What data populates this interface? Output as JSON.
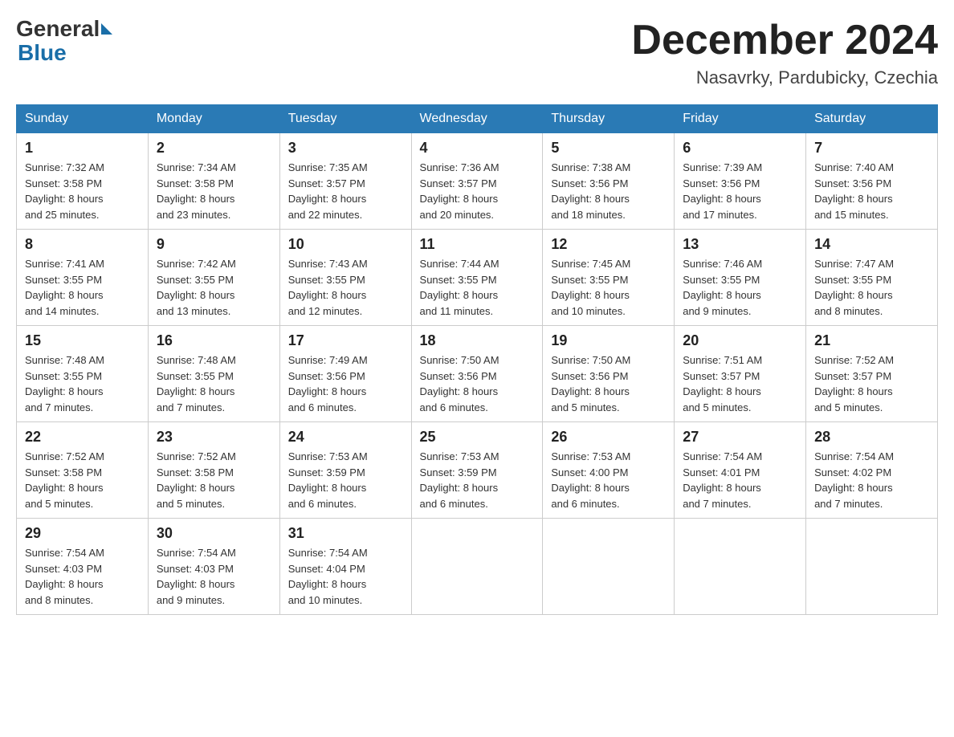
{
  "header": {
    "logo_general": "General",
    "logo_blue": "Blue",
    "title": "December 2024",
    "subtitle": "Nasavrky, Pardubicky, Czechia"
  },
  "days_of_week": [
    "Sunday",
    "Monday",
    "Tuesday",
    "Wednesday",
    "Thursday",
    "Friday",
    "Saturday"
  ],
  "weeks": [
    [
      {
        "day": "1",
        "sunrise": "7:32 AM",
        "sunset": "3:58 PM",
        "daylight": "8 hours and 25 minutes."
      },
      {
        "day": "2",
        "sunrise": "7:34 AM",
        "sunset": "3:58 PM",
        "daylight": "8 hours and 23 minutes."
      },
      {
        "day": "3",
        "sunrise": "7:35 AM",
        "sunset": "3:57 PM",
        "daylight": "8 hours and 22 minutes."
      },
      {
        "day": "4",
        "sunrise": "7:36 AM",
        "sunset": "3:57 PM",
        "daylight": "8 hours and 20 minutes."
      },
      {
        "day": "5",
        "sunrise": "7:38 AM",
        "sunset": "3:56 PM",
        "daylight": "8 hours and 18 minutes."
      },
      {
        "day": "6",
        "sunrise": "7:39 AM",
        "sunset": "3:56 PM",
        "daylight": "8 hours and 17 minutes."
      },
      {
        "day": "7",
        "sunrise": "7:40 AM",
        "sunset": "3:56 PM",
        "daylight": "8 hours and 15 minutes."
      }
    ],
    [
      {
        "day": "8",
        "sunrise": "7:41 AM",
        "sunset": "3:55 PM",
        "daylight": "8 hours and 14 minutes."
      },
      {
        "day": "9",
        "sunrise": "7:42 AM",
        "sunset": "3:55 PM",
        "daylight": "8 hours and 13 minutes."
      },
      {
        "day": "10",
        "sunrise": "7:43 AM",
        "sunset": "3:55 PM",
        "daylight": "8 hours and 12 minutes."
      },
      {
        "day": "11",
        "sunrise": "7:44 AM",
        "sunset": "3:55 PM",
        "daylight": "8 hours and 11 minutes."
      },
      {
        "day": "12",
        "sunrise": "7:45 AM",
        "sunset": "3:55 PM",
        "daylight": "8 hours and 10 minutes."
      },
      {
        "day": "13",
        "sunrise": "7:46 AM",
        "sunset": "3:55 PM",
        "daylight": "8 hours and 9 minutes."
      },
      {
        "day": "14",
        "sunrise": "7:47 AM",
        "sunset": "3:55 PM",
        "daylight": "8 hours and 8 minutes."
      }
    ],
    [
      {
        "day": "15",
        "sunrise": "7:48 AM",
        "sunset": "3:55 PM",
        "daylight": "8 hours and 7 minutes."
      },
      {
        "day": "16",
        "sunrise": "7:48 AM",
        "sunset": "3:55 PM",
        "daylight": "8 hours and 7 minutes."
      },
      {
        "day": "17",
        "sunrise": "7:49 AM",
        "sunset": "3:56 PM",
        "daylight": "8 hours and 6 minutes."
      },
      {
        "day": "18",
        "sunrise": "7:50 AM",
        "sunset": "3:56 PM",
        "daylight": "8 hours and 6 minutes."
      },
      {
        "day": "19",
        "sunrise": "7:50 AM",
        "sunset": "3:56 PM",
        "daylight": "8 hours and 5 minutes."
      },
      {
        "day": "20",
        "sunrise": "7:51 AM",
        "sunset": "3:57 PM",
        "daylight": "8 hours and 5 minutes."
      },
      {
        "day": "21",
        "sunrise": "7:52 AM",
        "sunset": "3:57 PM",
        "daylight": "8 hours and 5 minutes."
      }
    ],
    [
      {
        "day": "22",
        "sunrise": "7:52 AM",
        "sunset": "3:58 PM",
        "daylight": "8 hours and 5 minutes."
      },
      {
        "day": "23",
        "sunrise": "7:52 AM",
        "sunset": "3:58 PM",
        "daylight": "8 hours and 5 minutes."
      },
      {
        "day": "24",
        "sunrise": "7:53 AM",
        "sunset": "3:59 PM",
        "daylight": "8 hours and 6 minutes."
      },
      {
        "day": "25",
        "sunrise": "7:53 AM",
        "sunset": "3:59 PM",
        "daylight": "8 hours and 6 minutes."
      },
      {
        "day": "26",
        "sunrise": "7:53 AM",
        "sunset": "4:00 PM",
        "daylight": "8 hours and 6 minutes."
      },
      {
        "day": "27",
        "sunrise": "7:54 AM",
        "sunset": "4:01 PM",
        "daylight": "8 hours and 7 minutes."
      },
      {
        "day": "28",
        "sunrise": "7:54 AM",
        "sunset": "4:02 PM",
        "daylight": "8 hours and 7 minutes."
      }
    ],
    [
      {
        "day": "29",
        "sunrise": "7:54 AM",
        "sunset": "4:03 PM",
        "daylight": "8 hours and 8 minutes."
      },
      {
        "day": "30",
        "sunrise": "7:54 AM",
        "sunset": "4:03 PM",
        "daylight": "8 hours and 9 minutes."
      },
      {
        "day": "31",
        "sunrise": "7:54 AM",
        "sunset": "4:04 PM",
        "daylight": "8 hours and 10 minutes."
      },
      null,
      null,
      null,
      null
    ]
  ],
  "labels": {
    "sunrise_prefix": "Sunrise: ",
    "sunset_prefix": "Sunset: ",
    "daylight_prefix": "Daylight: "
  }
}
